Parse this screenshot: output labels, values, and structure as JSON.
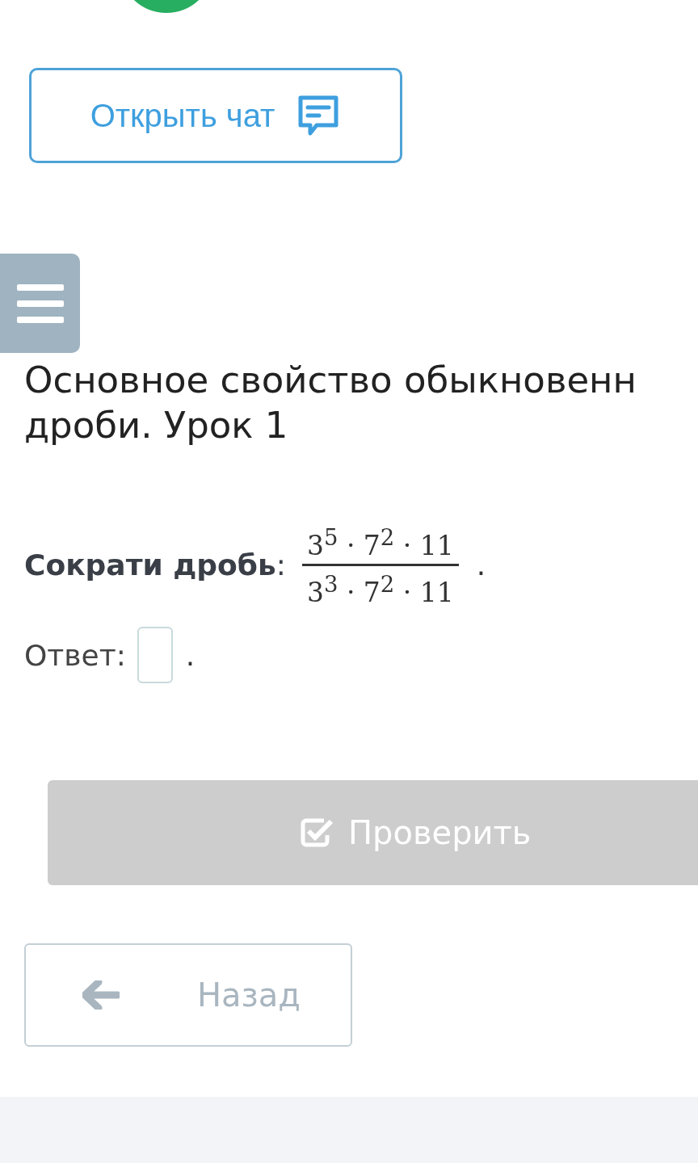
{
  "chat_button": {
    "label": "Открыть чат"
  },
  "title_lines": [
    "Основное свойство обыкновенн",
    "дроби. Урок 1"
  ],
  "task": {
    "prompt": "Сократи дробь",
    "colon": ":",
    "numerator": "3$^{5}$ · 7$^{2}$ · 11",
    "denominator": "3$^{3}$ · 7$^{2}$ · 11",
    "end": "."
  },
  "answer": {
    "label": "Ответ:",
    "end": "."
  },
  "check_button": {
    "label": "Проверить",
    "disabled": true
  },
  "back_button": {
    "label": "Назад"
  }
}
